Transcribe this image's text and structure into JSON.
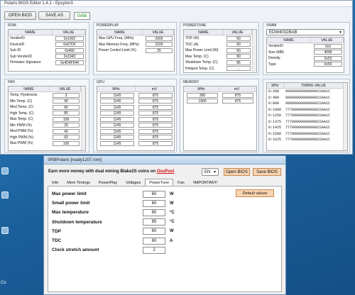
{
  "polaris": {
    "title": "Polaris BIOS Editor 1.4.1 - Epsylon3",
    "open_bios": "OPEN BIOS",
    "save_as": "SAVE AS",
    "device_tag": "0x58",
    "rom": {
      "title": "ROM",
      "headers": [
        "NAME",
        "VALUE"
      ],
      "rows": [
        [
          "VendorID",
          "0x1002"
        ],
        [
          "DeviceID",
          "0x67DF"
        ],
        [
          "Sub ID",
          "0x460"
        ],
        [
          "Sub VendorID",
          "0x1043"
        ],
        [
          "Firmware Signature",
          "0x4D4F544"
        ]
      ]
    },
    "powerplay": {
      "title": "POWERPLAY",
      "headers": [
        "NAME",
        "VALUE"
      ],
      "rows": [
        [
          "Max GPU Freq. (MHz)",
          "2000"
        ],
        [
          "Max Memory Freq. (MHz)",
          "2100"
        ],
        [
          "Power Control Limit (%)",
          "25"
        ]
      ]
    },
    "powertune": {
      "title": "POWERTUNE",
      "headers": [
        "NAME",
        "VALUE"
      ],
      "rows": [
        [
          "TDP (W)",
          "60"
        ],
        [
          "TDC (A)",
          "60"
        ],
        [
          "Max Power Limit (W)",
          "60"
        ],
        [
          "Max Temp. (C)",
          "80"
        ],
        [
          "Shutdown Temp. (C)",
          "85"
        ],
        [
          "Hotspot Temp. (C)",
          "..."
        ]
      ]
    },
    "vram": {
      "title": "VRAM",
      "selected": "EDW4032BAB",
      "headers": [
        "NAME",
        "VALUE"
      ],
      "rows": [
        [
          "VendorID",
          "0x3"
        ],
        [
          "Size (MB)",
          "4096"
        ],
        [
          "Density",
          "0x53"
        ],
        [
          "Type",
          "0x50"
        ]
      ]
    },
    "fan": {
      "title": "FAN",
      "headers": [
        "NAME",
        "VALUE"
      ],
      "rows": [
        [
          "Temp. Hysteresis",
          "3"
        ],
        [
          "Min Temp. (C)",
          "40"
        ],
        [
          "Med Temp. (C)",
          "65"
        ],
        [
          "High Temp. (C)",
          "85"
        ],
        [
          "Max Temp. (C)",
          "109"
        ],
        [
          "Min PWM (%)",
          "20"
        ],
        [
          "Med PWM (%)",
          "40"
        ],
        [
          "High PWM (%)",
          "60"
        ],
        [
          "Max PWM (%)",
          "100"
        ]
      ]
    },
    "gpu": {
      "title": "GPU",
      "headers": [
        "MHz",
        "mV"
      ],
      "rows": [
        [
          "1145",
          "875"
        ],
        [
          "1145",
          "875"
        ],
        [
          "1145",
          "875"
        ],
        [
          "1145",
          "875"
        ],
        [
          "1145",
          "875"
        ],
        [
          "1145",
          "875"
        ],
        [
          "1145",
          "875"
        ],
        [
          "1145",
          "875"
        ],
        [
          "1145",
          "875"
        ]
      ]
    },
    "memory": {
      "title": "MEMORY",
      "headers": [
        "MHz",
        "mV"
      ],
      "rows": [
        [
          "300",
          "875"
        ],
        [
          "1900",
          "875"
        ]
      ]
    },
    "timings": {
      "headers": [
        "MHz",
        "TIMING VALUE"
      ],
      "rows": [
        [
          "0:200",
          "99900000000000022AA1C"
        ],
        [
          "0:400",
          "99900000000000022AA1C"
        ],
        [
          "0:800",
          "99900000000000022AA1C"
        ],
        [
          "0:1000",
          "77700000000000022AA1C"
        ],
        [
          "0:1250",
          "77700000000000022AA1C"
        ],
        [
          "0:1375",
          "77700000000000022AA1C"
        ],
        [
          "0:1425",
          "77700000000000022AA1C"
        ],
        [
          "0:1500",
          "77700000000000022AA1C"
        ],
        [
          "0:1625",
          "77700000000000022AA1C"
        ]
      ]
    }
  },
  "srb": {
    "title": "SRBPolaris [ready1207.rom]",
    "promo_text": "Earn more money with dual mining Blake2S coins on ",
    "promo_link": "OxoPool",
    "language": "EN",
    "open_bios": "Open BIOS",
    "save_bios": "Save BIOS",
    "tabs": [
      "Info",
      "Mem Timings",
      "PowerPlay",
      "Voltages",
      "PowerTune",
      "Fan",
      "!IMPORTANT!"
    ],
    "active_tab": "PowerTune",
    "default_values": "Default values",
    "fields": [
      {
        "label": "Max power limit",
        "value": "60",
        "unit": "W"
      },
      {
        "label": "Small power limit",
        "value": "60",
        "unit": "W"
      },
      {
        "label": "Max temperature",
        "value": "80",
        "unit": "°C"
      },
      {
        "label": "Shutdown temperature",
        "value": "85",
        "unit": "°C"
      },
      {
        "label": "TDP",
        "value": "60",
        "unit": "W"
      },
      {
        "label": "TDC",
        "value": "60",
        "unit": "A"
      },
      {
        "label": "Clock stretch amount",
        "value": "2",
        "unit": ""
      }
    ]
  },
  "desktop": {
    "side_text": "Co"
  },
  "colors": {
    "desktop": "#1b6aa6",
    "accent_button": "#f9d4b0",
    "promo_link": "#d01010",
    "device_tag": "#0a8a0a"
  }
}
